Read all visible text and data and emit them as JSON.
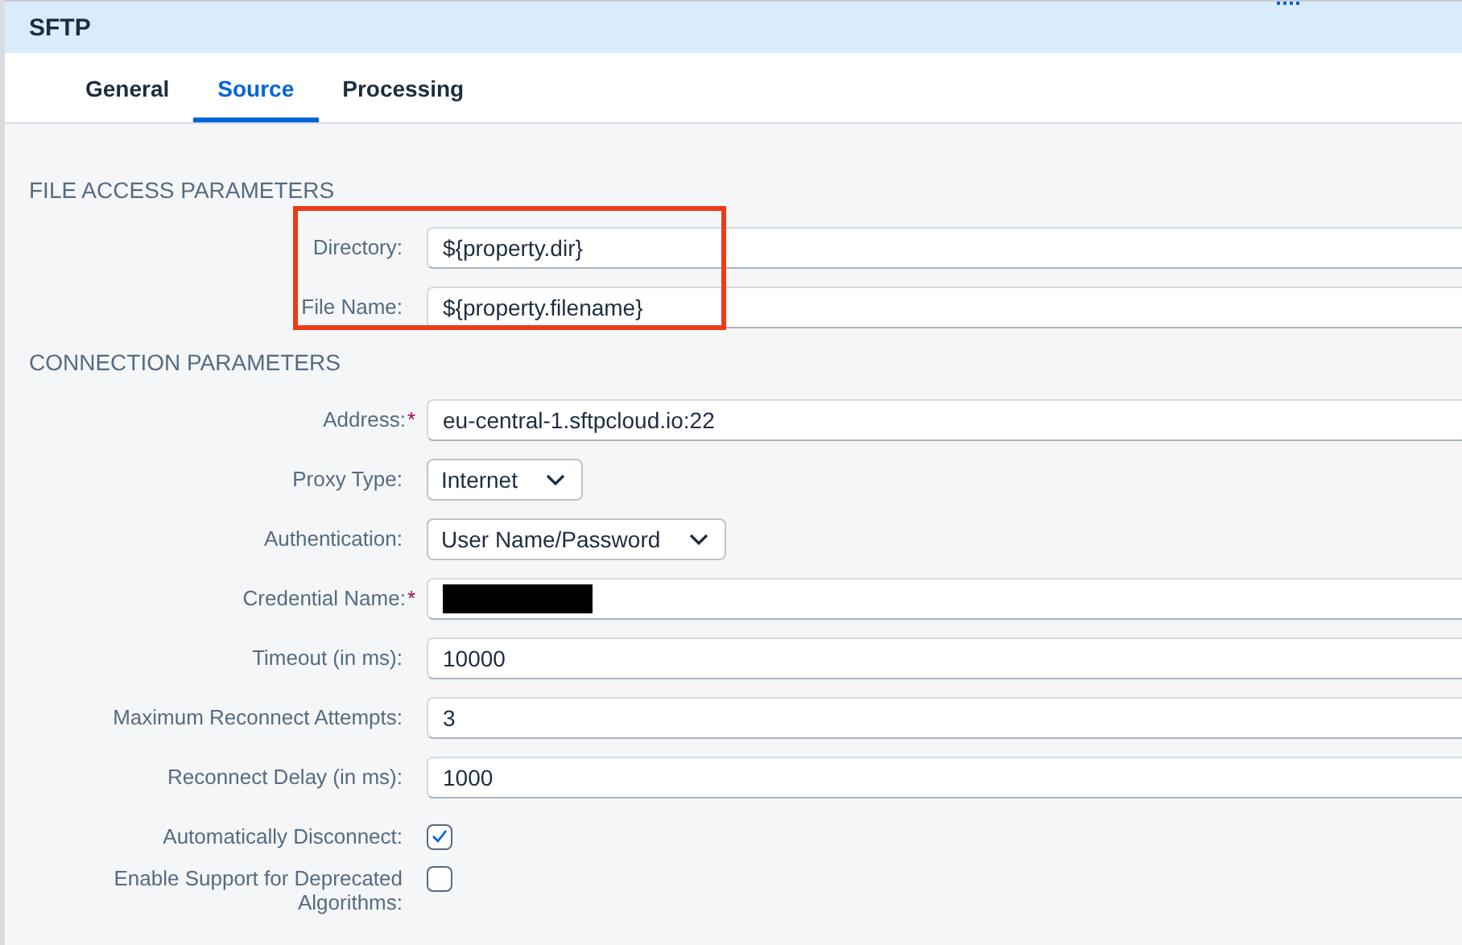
{
  "window": {
    "title": "SFTP"
  },
  "tabs": [
    {
      "label": "General",
      "selected": false
    },
    {
      "label": "Source",
      "selected": true
    },
    {
      "label": "Processing",
      "selected": false
    }
  ],
  "sections": [
    {
      "title": "FILE ACCESS PARAMETERS",
      "highlighted": true,
      "fields": [
        {
          "kind": "text",
          "label": "Directory:",
          "value": "${property.dir}"
        },
        {
          "kind": "text",
          "label": "File Name:",
          "value": "${property.filename}"
        }
      ]
    },
    {
      "title": "CONNECTION PARAMETERS",
      "highlighted": false,
      "fields": [
        {
          "kind": "text",
          "label": "Address:",
          "required_mark": "*",
          "value": "eu-central-1.sftpcloud.io:22"
        },
        {
          "kind": "select",
          "label": "Proxy Type:",
          "value": "Internet"
        },
        {
          "kind": "select",
          "label": "Authentication:",
          "value": "User Name/Password"
        },
        {
          "kind": "redacted",
          "label": "Credential Name:",
          "required_mark": "*"
        },
        {
          "kind": "text",
          "label": "Timeout (in ms):",
          "value": "10000"
        },
        {
          "kind": "text",
          "label": "Maximum Reconnect Attempts:",
          "value": "3"
        },
        {
          "kind": "text",
          "label": "Reconnect Delay (in ms):",
          "value": "1000"
        },
        {
          "kind": "checkbox",
          "label": "Automatically Disconnect:",
          "checked": true
        },
        {
          "kind": "checkbox",
          "label": "Enable Support for Deprecated Algorithms:",
          "checked": false
        }
      ]
    }
  ]
}
